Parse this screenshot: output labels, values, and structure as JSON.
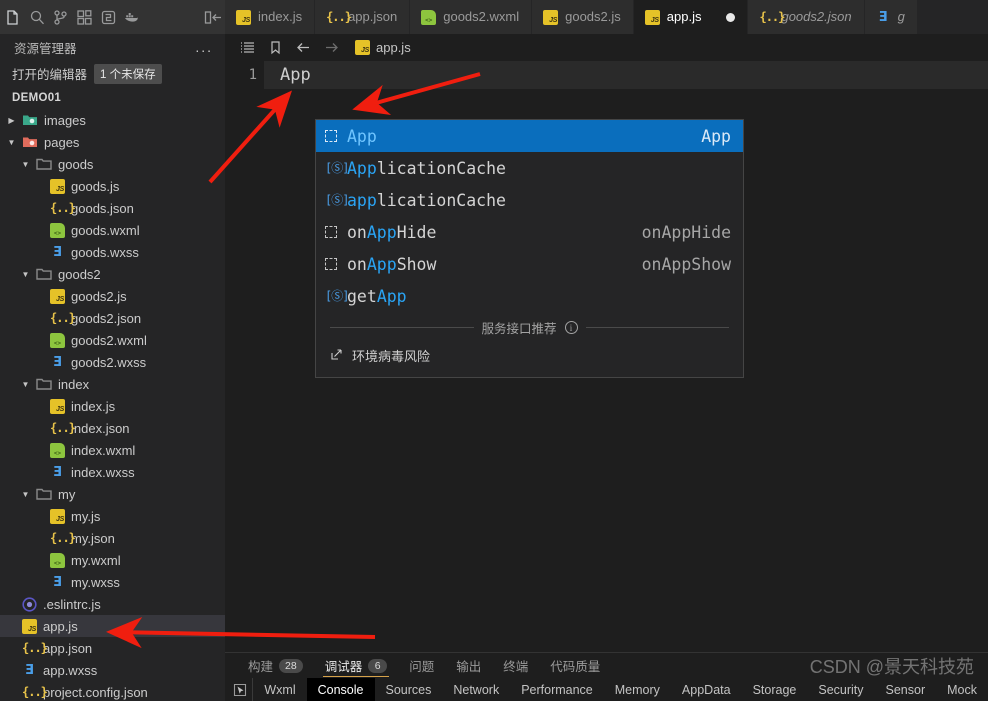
{
  "window": {
    "accent_blue": "#0a6ebd",
    "arrow_color": "#f01e0f",
    "watermark": "CSDN @景天科技苑"
  },
  "activity_bar": {
    "icons": [
      {
        "name": "files-explorer-icon"
      },
      {
        "name": "search-icon"
      },
      {
        "name": "source-control-icon"
      },
      {
        "name": "extensions-icon"
      },
      {
        "name": "run-debug-icon"
      },
      {
        "name": "docker-icon"
      },
      {
        "name": "toggle-panel-icon"
      }
    ]
  },
  "tabs": [
    {
      "label": "index.js",
      "icon": "js-file-icon",
      "active": false,
      "dirty": false,
      "preview": false
    },
    {
      "label": "app.json",
      "icon": "json-file-icon",
      "active": false,
      "dirty": false,
      "preview": false
    },
    {
      "label": "goods2.wxml",
      "icon": "wxml-file-icon",
      "active": false,
      "dirty": false,
      "preview": false
    },
    {
      "label": "goods2.js",
      "icon": "js-file-icon",
      "active": false,
      "dirty": false,
      "preview": false
    },
    {
      "label": "app.js",
      "icon": "js-file-icon",
      "active": true,
      "dirty": true,
      "preview": false
    },
    {
      "label": "goods2.json",
      "icon": "json-file-icon",
      "active": false,
      "dirty": false,
      "preview": true
    },
    {
      "label": "g",
      "icon": "wxss-file-icon",
      "active": false,
      "dirty": false,
      "preview": true
    }
  ],
  "sidebar": {
    "title": "资源管理器",
    "more_label": "...",
    "open_editors_label": "打开的编辑器",
    "unsaved_badge": "1 个未保存",
    "project_name": "DEMO01",
    "tree": [
      {
        "label": "images",
        "type": "folder",
        "indent": 0,
        "expanded": false,
        "icon": "folder-images-icon"
      },
      {
        "label": "pages",
        "type": "folder",
        "indent": 0,
        "expanded": true,
        "icon": "folder-pages-icon"
      },
      {
        "label": "goods",
        "type": "folder",
        "indent": 1,
        "expanded": true,
        "icon": "folder-icon"
      },
      {
        "label": "goods.js",
        "type": "js",
        "indent": 2
      },
      {
        "label": "goods.json",
        "type": "json",
        "indent": 2
      },
      {
        "label": "goods.wxml",
        "type": "wxml",
        "indent": 2
      },
      {
        "label": "goods.wxss",
        "type": "wxss",
        "indent": 2
      },
      {
        "label": "goods2",
        "type": "folder",
        "indent": 1,
        "expanded": true,
        "icon": "folder-icon"
      },
      {
        "label": "goods2.js",
        "type": "js",
        "indent": 2
      },
      {
        "label": "goods2.json",
        "type": "json",
        "indent": 2
      },
      {
        "label": "goods2.wxml",
        "type": "wxml",
        "indent": 2
      },
      {
        "label": "goods2.wxss",
        "type": "wxss",
        "indent": 2
      },
      {
        "label": "index",
        "type": "folder",
        "indent": 1,
        "expanded": true,
        "icon": "folder-icon"
      },
      {
        "label": "index.js",
        "type": "js",
        "indent": 2
      },
      {
        "label": "index.json",
        "type": "json",
        "indent": 2
      },
      {
        "label": "index.wxml",
        "type": "wxml",
        "indent": 2
      },
      {
        "label": "index.wxss",
        "type": "wxss",
        "indent": 2
      },
      {
        "label": "my",
        "type": "folder",
        "indent": 1,
        "expanded": true,
        "icon": "folder-icon"
      },
      {
        "label": "my.js",
        "type": "js",
        "indent": 2
      },
      {
        "label": "my.json",
        "type": "json",
        "indent": 2
      },
      {
        "label": "my.wxml",
        "type": "wxml",
        "indent": 2
      },
      {
        "label": "my.wxss",
        "type": "wxss",
        "indent": 2
      },
      {
        "label": ".eslintrc.js",
        "type": "eslint",
        "indent": 0
      },
      {
        "label": "app.js",
        "type": "js",
        "indent": 0,
        "selected": true
      },
      {
        "label": "app.json",
        "type": "json",
        "indent": 0
      },
      {
        "label": "app.wxss",
        "type": "wxss",
        "indent": 0
      },
      {
        "label": "project.config.json",
        "type": "json",
        "indent": 0
      }
    ]
  },
  "breadcrumb": {
    "icons": [
      "outline-icon",
      "bookmark-icon",
      "back-arrow-icon",
      "forward-arrow-icon"
    ],
    "file": "app.js",
    "file_icon": "js-file-icon"
  },
  "editor": {
    "line_number": "1",
    "line_text": "App"
  },
  "suggest": {
    "items": [
      {
        "icon": "snippet-icon",
        "prefix": "",
        "match": "App",
        "suffix": "",
        "detail": "App",
        "selected": true
      },
      {
        "icon": "property-icon",
        "prefix": "",
        "match": "App",
        "suffix": "licationCache",
        "detail": "",
        "selected": false
      },
      {
        "icon": "property-icon",
        "prefix": "",
        "match": "app",
        "suffix": "licationCache",
        "detail": "",
        "selected": false
      },
      {
        "icon": "snippet-icon",
        "prefix": "on",
        "match": "App",
        "suffix": "Hide",
        "detail": "onAppHide",
        "selected": false
      },
      {
        "icon": "snippet-icon",
        "prefix": "on",
        "match": "App",
        "suffix": "Show",
        "detail": "onAppShow",
        "selected": false
      },
      {
        "icon": "property-icon",
        "prefix": "get",
        "match": "App",
        "suffix": "",
        "detail": "",
        "selected": false
      }
    ],
    "separator_label": "服务接口推荐",
    "separator_info_icon": "info-icon",
    "extra_item": {
      "label": "环境病毒风险",
      "icon": "external-link-icon"
    }
  },
  "panel": {
    "tabs": [
      {
        "label": "构建",
        "count": "28",
        "active": false
      },
      {
        "label": "调试器",
        "count": "6",
        "active": true
      },
      {
        "label": "问题",
        "count": "",
        "active": false
      },
      {
        "label": "输出",
        "count": "",
        "active": false
      },
      {
        "label": "终端",
        "count": "",
        "active": false
      },
      {
        "label": "代码质量",
        "count": "",
        "active": false
      }
    ],
    "devtools_cursor_icon": "inspect-element-icon",
    "devtools_tabs": [
      {
        "label": "Wxml",
        "active": false
      },
      {
        "label": "Console",
        "active": true
      },
      {
        "label": "Sources",
        "active": false
      },
      {
        "label": "Network",
        "active": false
      },
      {
        "label": "Performance",
        "active": false
      },
      {
        "label": "Memory",
        "active": false
      },
      {
        "label": "AppData",
        "active": false
      },
      {
        "label": "Storage",
        "active": false
      },
      {
        "label": "Security",
        "active": false
      },
      {
        "label": "Sensor",
        "active": false
      },
      {
        "label": "Mock",
        "active": false
      }
    ]
  }
}
